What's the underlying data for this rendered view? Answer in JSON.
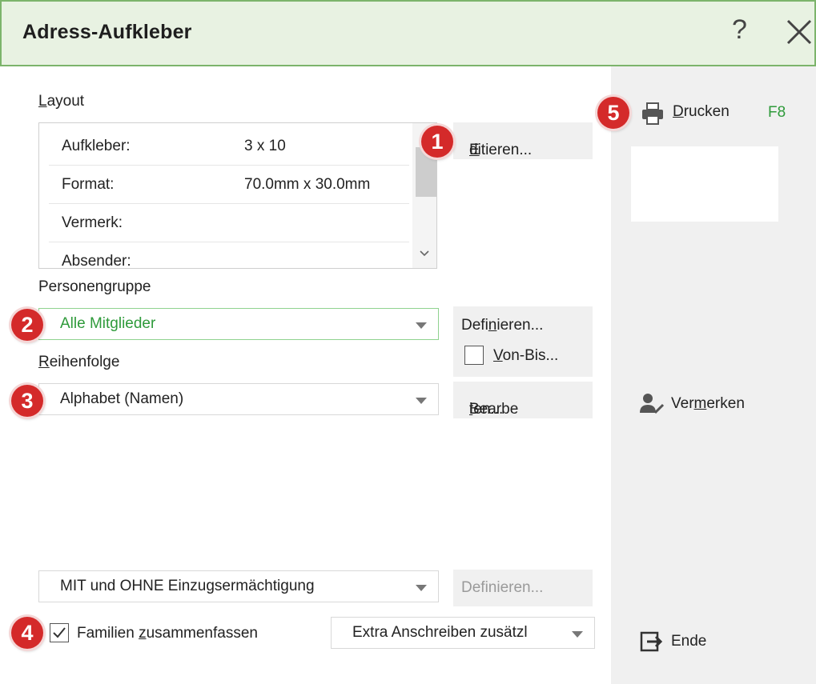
{
  "window": {
    "title": "Adress-Aufkleber",
    "help_icon": "?",
    "close_icon": "close-icon"
  },
  "layout": {
    "section_label_u": "L",
    "section_label_rest": "ayout",
    "rows": [
      {
        "key": "Aufkleber:",
        "value": "3 x 10"
      },
      {
        "key": "Format:",
        "value": "70.0mm x 30.0mm"
      },
      {
        "key": "Vermerk:",
        "value": ""
      },
      {
        "key": "Absender:",
        "value": ""
      }
    ],
    "edit_button_u": "E",
    "edit_button_rest": "ditieren..."
  },
  "personengruppe": {
    "label": "Personengruppe",
    "value": "Alle Mitglieder",
    "define_pre": "Defi",
    "define_u": "n",
    "define_post": "ieren...",
    "vonbis_u": "V",
    "vonbis_rest": "on-Bis..."
  },
  "reihenfolge": {
    "label_u": "R",
    "label_rest": "eihenfolge",
    "value": "Alphabet (Namen)",
    "edit_pre": "Bearbe",
    "edit_u": "i",
    "edit_post": "ten..."
  },
  "einzug": {
    "value": "MIT und OHNE Einzugsermächtigung",
    "define_label": "Definieren..."
  },
  "familien": {
    "checked": true,
    "label_pre": "Familien ",
    "label_u": "z",
    "label_post": "usammenfassen",
    "extra_value": "Extra Anschreiben zusätzl"
  },
  "side": {
    "print_u": "D",
    "print_rest": "rucken",
    "print_shortcut": "F8",
    "vermerken_pre": "Ver",
    "vermerken_u": "m",
    "vermerken_post": "erken",
    "ende_label": "Ende"
  },
  "badges": [
    "1",
    "2",
    "3",
    "4",
    "5"
  ],
  "colors": {
    "title_bg": "#e8f2e2",
    "title_border": "#7cb46b",
    "accent_green": "#2e9a3a",
    "badge_red": "#d42a2a"
  }
}
